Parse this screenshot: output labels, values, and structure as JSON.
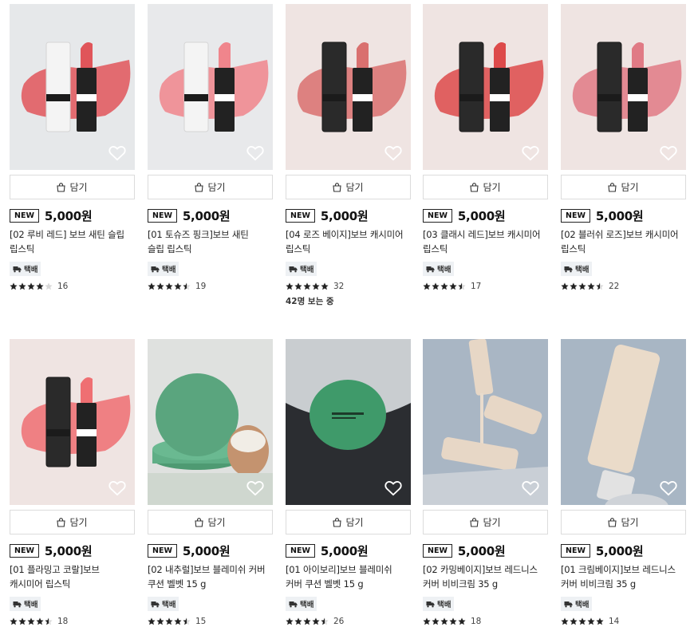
{
  "cart_label": "담기",
  "badge_label": "NEW",
  "shipping_label": "택배",
  "products": [
    {
      "name_line1": "[02 루비 레드] 보브 새틴 슬립",
      "name_line2": "립스틱",
      "price": "5,000원",
      "rating": 4,
      "reviews": "16",
      "viewers": "",
      "image": "lipstick-white",
      "accent": "#e0555a",
      "bg": "#e6e8ea"
    },
    {
      "name_line1": "[01 토슈즈 핑크]보브 새틴",
      "name_line2": "슬립 립스틱",
      "price": "5,000원",
      "rating": 4.5,
      "reviews": "19",
      "viewers": "",
      "image": "lipstick-white",
      "accent": "#f0858c",
      "bg": "#e8e9eb"
    },
    {
      "name_line1": "[04 로즈 베이지]보브 캐시미어",
      "name_line2": "립스틱",
      "price": "5,000원",
      "rating": 5,
      "reviews": "32",
      "viewers": "42명 보는 중",
      "image": "lipstick-black",
      "accent": "#d9706f",
      "bg": "#efe4e2"
    },
    {
      "name_line1": "[03 클래시 레드]보브 캐시미어",
      "name_line2": "립스틱",
      "price": "5,000원",
      "rating": 4.5,
      "reviews": "17",
      "viewers": "",
      "image": "lipstick-black",
      "accent": "#dd4a4a",
      "bg": "#efe4e2"
    },
    {
      "name_line1": "[02 블러쉬 로즈]보브 캐시미어",
      "name_line2": "립스틱",
      "price": "5,000원",
      "rating": 4.5,
      "reviews": "22",
      "viewers": "",
      "image": "lipstick-black",
      "accent": "#e07a85",
      "bg": "#efe4e2"
    },
    {
      "name_line1": "[01 플라밍고 코랄]보브",
      "name_line2": "캐시미어 립스틱",
      "price": "5,000원",
      "rating": 4.5,
      "reviews": "18",
      "viewers": "",
      "image": "lipstick-black",
      "accent": "#ef6f72",
      "bg": "#efe4e2"
    },
    {
      "name_line1": "[02 내추럴]보브 블레미쉬 커버",
      "name_line2": "쿠션 벨벳 15 g",
      "price": "5,000원",
      "rating": 4.5,
      "reviews": "15",
      "viewers": "",
      "image": "cushion-egg",
      "accent": "#5aa57e",
      "bg": "#dfe1df"
    },
    {
      "name_line1": "[01 아이보리]보브 블레미쉬",
      "name_line2": "커버 쿠션 벨벳 15 g",
      "price": "5,000원",
      "rating": 4.5,
      "reviews": "26",
      "viewers": "",
      "image": "cushion-dark",
      "accent": "#3f9a6a",
      "bg": "#c9cdd0"
    },
    {
      "name_line1": "[02 카밍베이지]보브 레드니스",
      "name_line2": "커버 비비크림 35 g",
      "price": "5,000원",
      "rating": 5,
      "reviews": "18",
      "viewers": "",
      "image": "tubes",
      "accent": "#e7d7c6",
      "bg": "#a9b6c4"
    },
    {
      "name_line1": "[01 크림베이지]보브 레드니스",
      "name_line2": "커버 비비크림 35 g",
      "price": "5,000원",
      "rating": 5,
      "reviews": "14",
      "viewers": "",
      "image": "tube-single",
      "accent": "#eadbc9",
      "bg": "#a8b6c4"
    }
  ],
  "colors": {
    "text": "#111111",
    "badge_border": "#222222",
    "ship_bg": "#eef1f4",
    "star": "#222222"
  }
}
